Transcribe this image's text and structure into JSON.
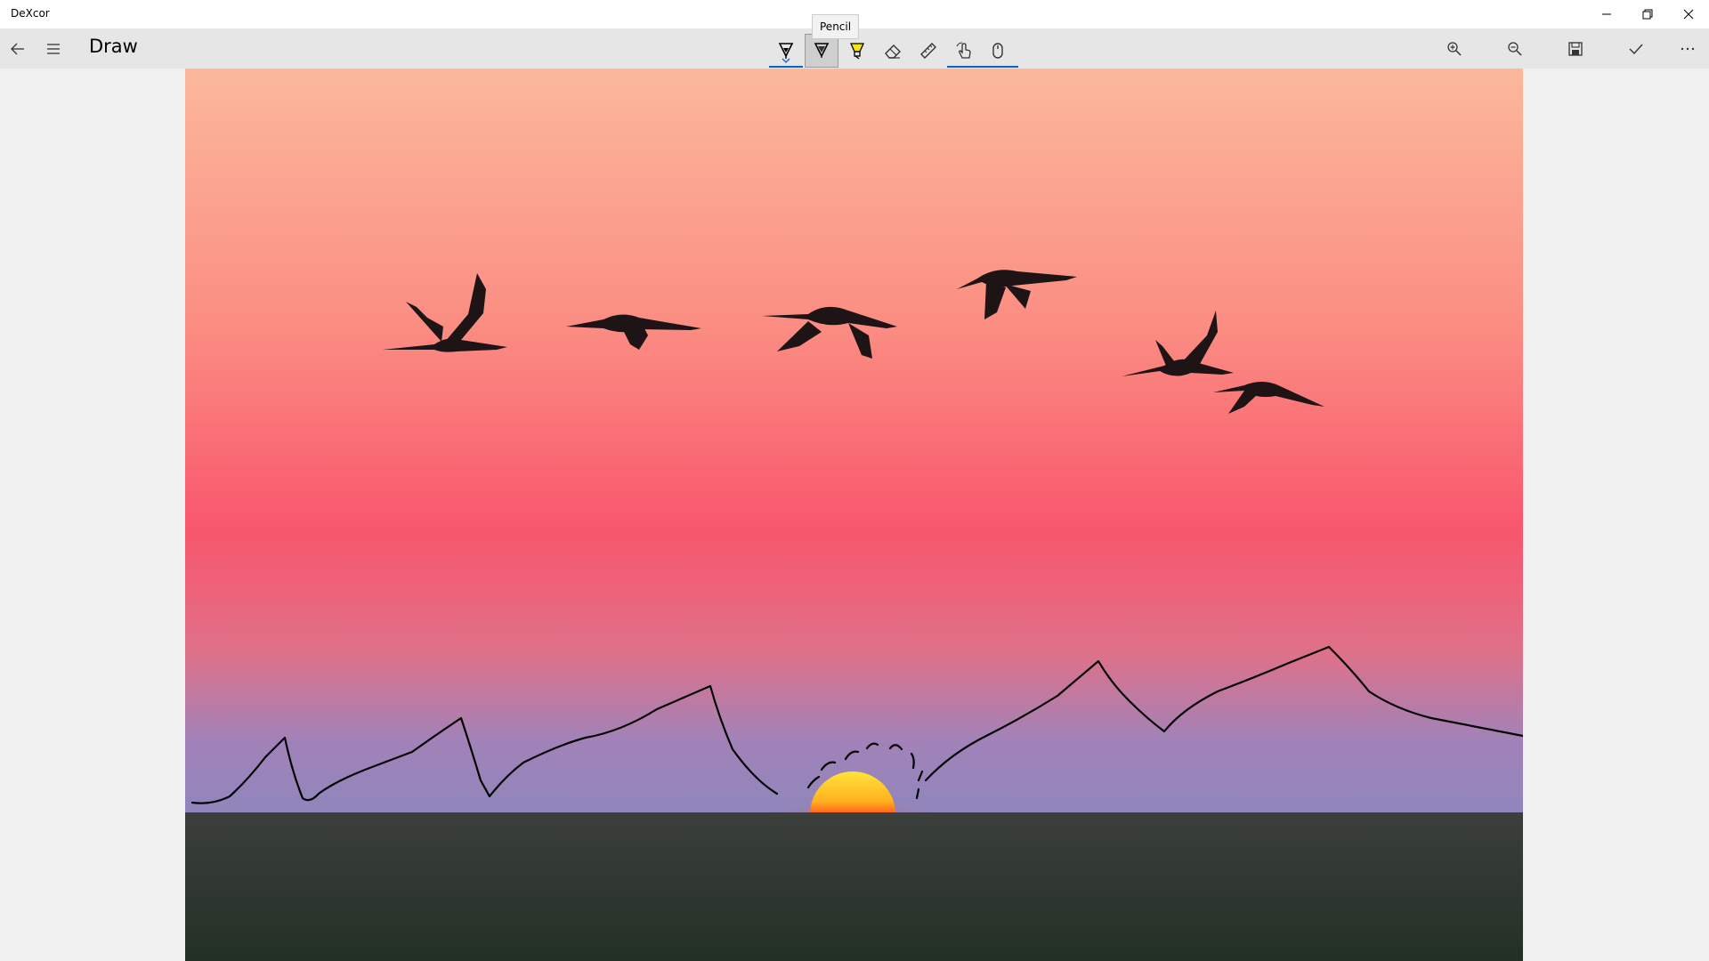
{
  "window": {
    "app_title": "DeXcor",
    "controls": [
      "minimize-icon",
      "restore-icon",
      "close-icon"
    ]
  },
  "command_bar": {
    "back": "back-arrow-icon",
    "menu": "hamburger-menu-icon",
    "page_title": "Draw",
    "tools": [
      {
        "name": "ballpoint-pen",
        "icon": "pen-icon"
      },
      {
        "name": "pencil",
        "icon": "pencil-icon",
        "selected": true
      },
      {
        "name": "highlighter",
        "icon": "highlighter-icon"
      },
      {
        "name": "eraser",
        "icon": "eraser-icon"
      },
      {
        "name": "ruler",
        "icon": "ruler-icon"
      },
      {
        "name": "touch-writing",
        "icon": "touch-hand-icon"
      },
      {
        "name": "mouse-input",
        "icon": "mouse-icon"
      }
    ],
    "tooltip": "Pencil",
    "actions": [
      "zoom-in-icon",
      "zoom-out-icon",
      "save-icon",
      "checkmark-icon",
      "more-icon"
    ]
  },
  "canvas": {
    "image": "sunset-with-birds",
    "colors": {
      "sky_top": "#fbb69a",
      "sky_mid": "#f85a6a",
      "sky_low": "#a87bb0",
      "ground": "#2e3830",
      "ink": "#000000",
      "sun": "#ffd21e"
    }
  }
}
